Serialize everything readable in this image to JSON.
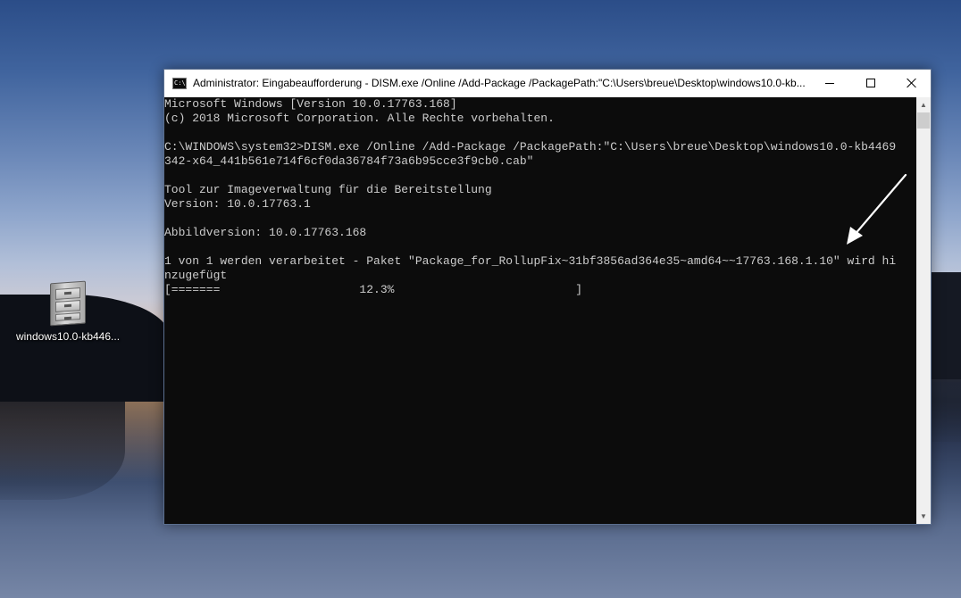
{
  "desktop": {
    "icon_label": "windows10.0-kb446..."
  },
  "window": {
    "title": "Administrator: Eingabeaufforderung - DISM.exe  /Online /Add-Package /PackagePath:\"C:\\Users\\breue\\Desktop\\windows10.0-kb...",
    "icon_glyph": "C:\\",
    "controls": {
      "minimize": "minimize-icon",
      "maximize": "maximize-icon",
      "close": "close-icon"
    }
  },
  "console": {
    "lines": [
      "Microsoft Windows [Version 10.0.17763.168]",
      "(c) 2018 Microsoft Corporation. Alle Rechte vorbehalten.",
      "",
      "C:\\WINDOWS\\system32>DISM.exe /Online /Add-Package /PackagePath:\"C:\\Users\\breue\\Desktop\\windows10.0-kb4469",
      "342-x64_441b561e714f6cf0da36784f73a6b95cce3f9cb0.cab\"",
      "",
      "Tool zur Imageverwaltung für die Bereitstellung",
      "Version: 10.0.17763.1",
      "",
      "Abbildversion: 10.0.17763.168",
      "",
      "1 von 1 werden verarbeitet - Paket \"Package_for_RollupFix~31bf3856ad364e35~amd64~~17763.168.1.10\" wird hi",
      "nzugefügt",
      "[=======                    12.3%                          ]"
    ]
  },
  "annotation": {
    "icon": "arrow-pointer-icon",
    "color": "#ffffff"
  }
}
